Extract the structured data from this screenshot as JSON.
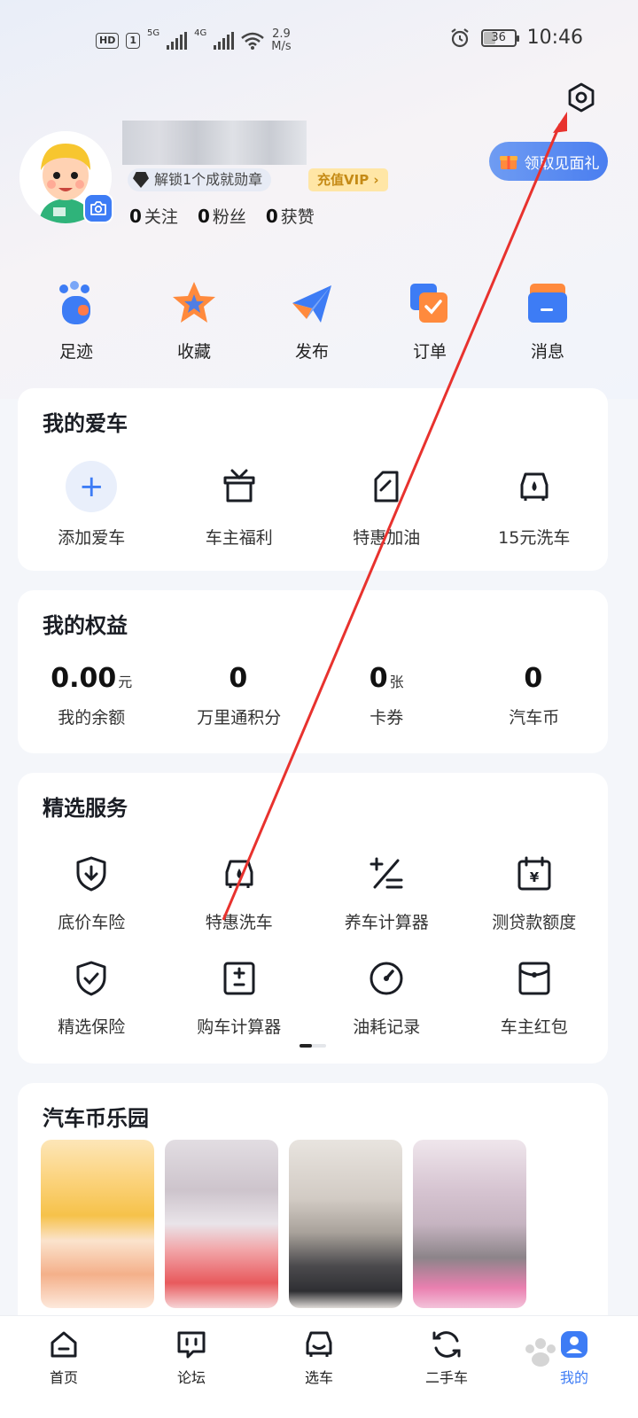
{
  "status_bar": {
    "hd": "HD",
    "sim": "1",
    "net1": "5G",
    "net2": "4G",
    "speed_value": "2.9",
    "speed_unit": "M/s",
    "battery": "36",
    "time": "10:46"
  },
  "profile": {
    "medal_text": "解锁1个成就勋章",
    "vip_label": "充值VIP",
    "vip_arrow": "›",
    "stats": [
      {
        "count": "0",
        "label": "关注"
      },
      {
        "count": "0",
        "label": "粉丝"
      },
      {
        "count": "0",
        "label": "获赞"
      }
    ],
    "gift_label": "领取见面礼"
  },
  "quick_actions": [
    {
      "label": "足迹",
      "icon": "footprint-icon"
    },
    {
      "label": "收藏",
      "icon": "star-icon"
    },
    {
      "label": "发布",
      "icon": "paper-plane-icon"
    },
    {
      "label": "订单",
      "icon": "order-icon"
    },
    {
      "label": "消息",
      "icon": "message-icon"
    }
  ],
  "my_car": {
    "title": "我的爱车",
    "items": [
      {
        "label": "添加爱车",
        "icon": "plus-icon"
      },
      {
        "label": "车主福利",
        "icon": "gift-box-icon"
      },
      {
        "label": "特惠加油",
        "icon": "fuel-can-icon"
      },
      {
        "label": "15元洗车",
        "icon": "car-wash-icon"
      }
    ]
  },
  "benefits": {
    "title": "我的权益",
    "items": [
      {
        "value": "0.00",
        "unit": "元",
        "label": "我的余额"
      },
      {
        "value": "0",
        "unit": "",
        "label": "万里通积分"
      },
      {
        "value": "0",
        "unit": "张",
        "label": "卡券"
      },
      {
        "value": "0",
        "unit": "",
        "label": "汽车币"
      }
    ]
  },
  "services": {
    "title": "精选服务",
    "row1": [
      {
        "label": "底价车险",
        "icon": "shield-download-icon"
      },
      {
        "label": "特惠洗车",
        "icon": "car-wash-icon"
      },
      {
        "label": "养车计算器",
        "icon": "calculator-icon"
      },
      {
        "label": "测贷款额度",
        "icon": "loan-calendar-icon"
      }
    ],
    "row2": [
      {
        "label": "精选保险",
        "icon": "shield-check-icon"
      },
      {
        "label": "购车计算器",
        "icon": "calculator-box-icon"
      },
      {
        "label": "油耗记录",
        "icon": "gauge-icon"
      },
      {
        "label": "车主红包",
        "icon": "red-envelope-icon"
      }
    ]
  },
  "coin_park": {
    "title": "汽车币乐园"
  },
  "bottom_nav": [
    {
      "label": "首页",
      "icon": "home-icon",
      "active": false
    },
    {
      "label": "论坛",
      "icon": "forum-icon",
      "active": false
    },
    {
      "label": "选车",
      "icon": "car-select-icon",
      "active": false
    },
    {
      "label": "二手车",
      "icon": "used-car-icon",
      "active": false
    },
    {
      "label": "我的",
      "icon": "profile-icon",
      "active": true
    }
  ],
  "colors": {
    "accent": "#3d7cf5",
    "annotation_arrow": "#e8322e",
    "vip_text": "#c58a15"
  }
}
